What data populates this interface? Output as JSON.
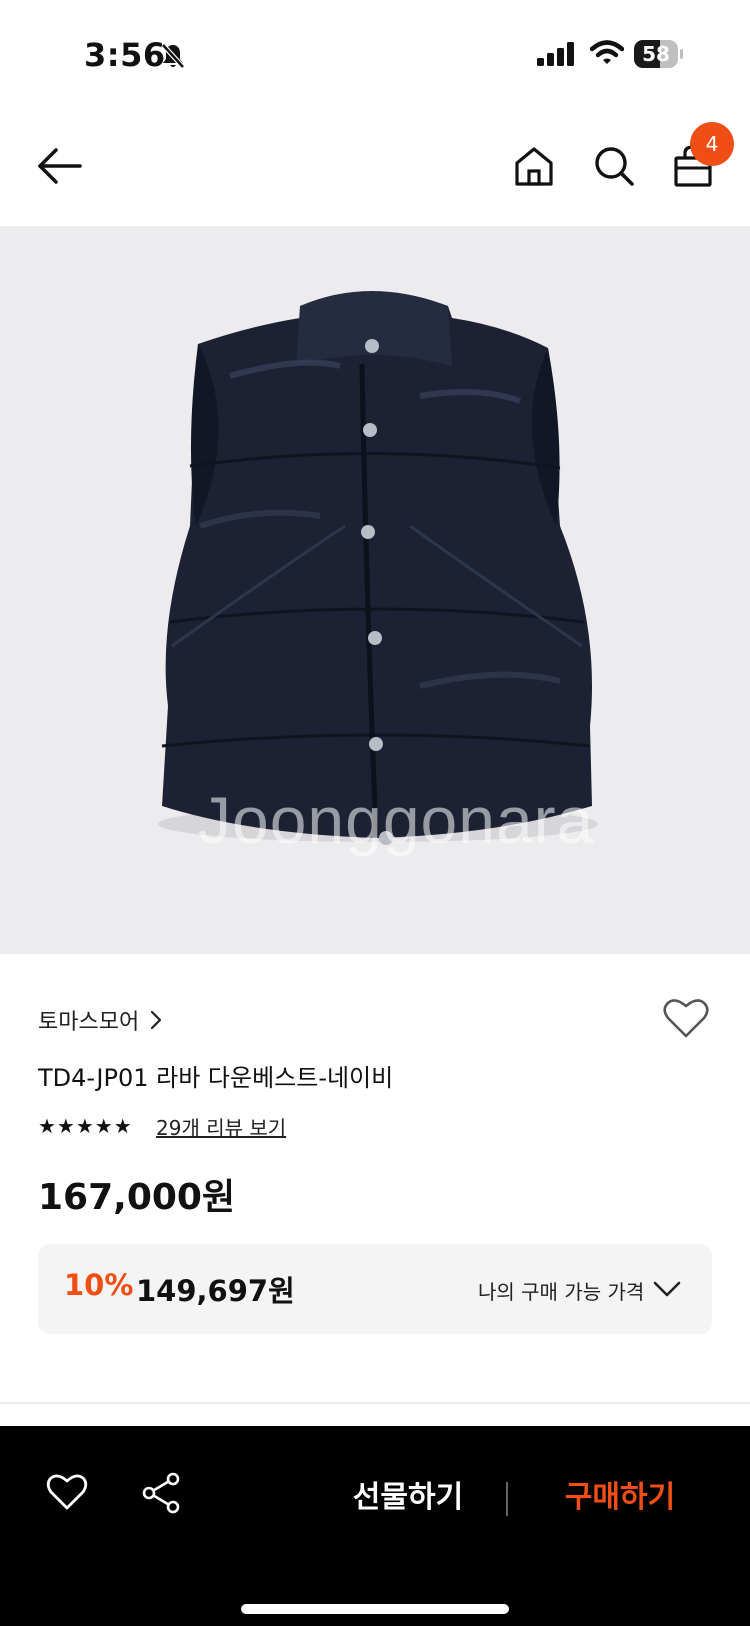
{
  "status": {
    "time": "3:56",
    "battery_percent": 58,
    "battery_text": "58"
  },
  "nav": {
    "cart_count": "4"
  },
  "image": {
    "watermark": "Joonggonara"
  },
  "product": {
    "brand": "토마스모어",
    "title": "TD4-JP01 라바 다운베스트-네이비",
    "stars": "★★★★★",
    "rating": 5,
    "review_link": "29개 리뷰 보기",
    "price": "167,000원"
  },
  "discount": {
    "rate": "10%",
    "price": "149,697원",
    "label": "나의 구매 가능 가격"
  },
  "bottom_bar": {
    "gift_label": "선물하기",
    "buy_label": "구매하기"
  },
  "colors": {
    "accent": "#f04e14",
    "bottom_bar": "#000000",
    "image_bg": "#ececee",
    "vest": "#1c2233"
  }
}
